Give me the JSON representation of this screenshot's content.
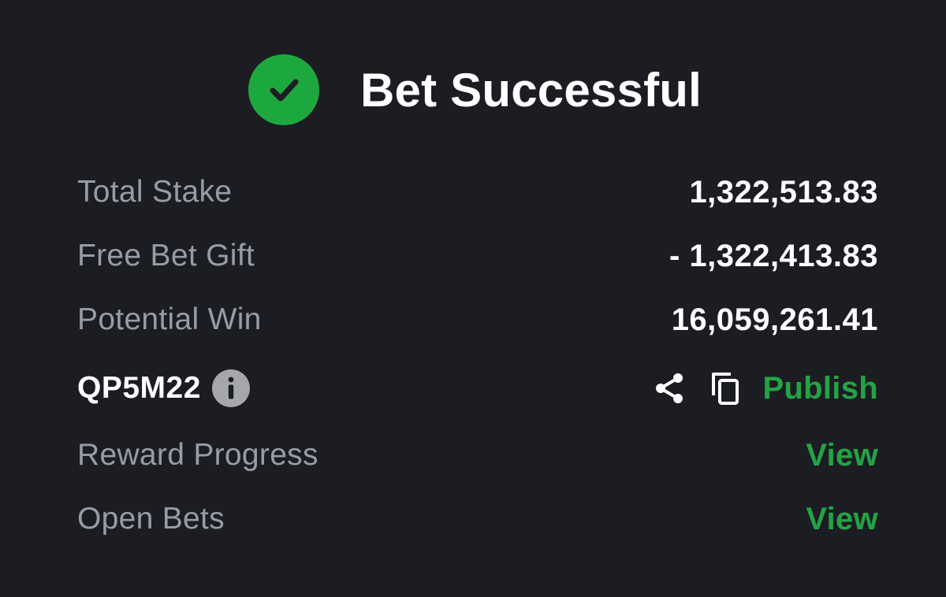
{
  "header": {
    "title": "Bet Successful",
    "icon": "check-circle-icon"
  },
  "summary": {
    "total_stake_label": "Total Stake",
    "total_stake_value": "1,322,513.83",
    "free_bet_label": "Free Bet Gift",
    "free_bet_value": "- 1,322,413.83",
    "potential_win_label": "Potential Win",
    "potential_win_value": "16,059,261.41"
  },
  "booking": {
    "code": "QP5M22",
    "info_icon": "info-icon",
    "share_icon": "share-icon",
    "copy_icon": "copy-icon",
    "publish_label": "Publish"
  },
  "links": {
    "reward_progress_label": "Reward Progress",
    "reward_progress_action": "View",
    "open_bets_label": "Open Bets",
    "open_bets_action": "View"
  },
  "colors": {
    "background": "#1b1d23",
    "accent_green": "#1da83f",
    "label_gray": "#9a9ca4",
    "value_white": "#ffffff"
  }
}
